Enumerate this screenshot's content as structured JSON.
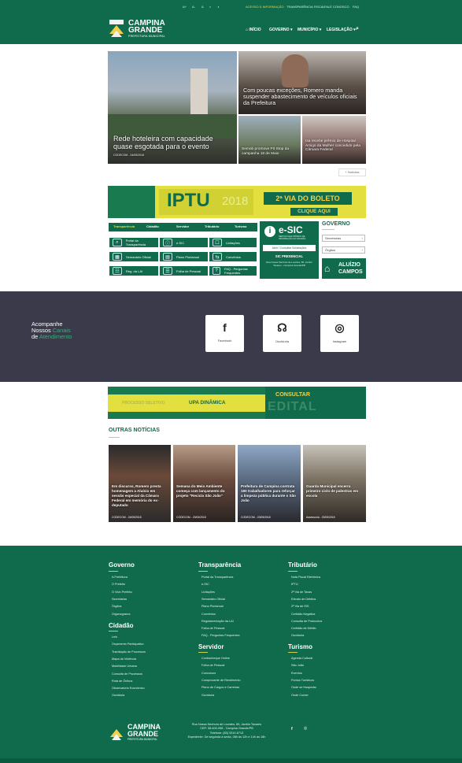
{
  "topbar": {
    "items": [
      "A+",
      "A-",
      "A",
      "◐",
      "◑",
      "ACESSO À INFORMAÇÃO",
      "TRANSPARÊNCIA FISCAL",
      "FALE CONOSCO",
      "FAQ"
    ]
  },
  "header": {
    "logo_line1": "CAMPINA",
    "logo_line2": "GRANDE",
    "logo_sub": "PREFEITURA MUNICIPAL",
    "nav": [
      "INÍCIO",
      "GOVERNO",
      "MUNICÍPIO",
      "LEGISLAÇÃO"
    ]
  },
  "slides": {
    "big": {
      "title": "Rede hoteleira com capacidade quase esgotada para o evento",
      "meta": "CODECOM - 24/05/2018"
    },
    "r1": {
      "title": "Com poucas exceções, Romero manda suspender abastecimento de veículos oficiais da Prefeitura"
    },
    "r2": {
      "title": "Semob promove Pit Stop da campanha 18 de Maio"
    },
    "r3": {
      "title": "Isa recebe prêmio de Hospital Amigo da Mulher concedido pela Câmara Federal"
    },
    "more": "Notícias"
  },
  "iptu": {
    "word": "IPTU",
    "year": "2018",
    "via": "2ª VIA DO BOLETO",
    "click": "CLIQUE AQUI"
  },
  "tabs": [
    "Transparência",
    "Cidadão",
    "Servidor",
    "Tributário",
    "Turismo"
  ],
  "services": [
    {
      "label": "Portal da Transparência",
      "icon": "⌕"
    },
    {
      "label": "e-SIC",
      "icon": "ⓘ"
    },
    {
      "label": "Licitações",
      "icon": "☐"
    },
    {
      "label": "Semanário Oficial",
      "icon": "▦"
    },
    {
      "label": "Plano Plurianual",
      "icon": "▤"
    },
    {
      "label": "Convênios",
      "icon": "⇆"
    },
    {
      "label": "Reg. da LAI",
      "icon": "☷"
    },
    {
      "label": "Folha de Pessoal",
      "icon": "☰"
    },
    {
      "label": "FAQ - Perguntas Frequentes",
      "icon": "?"
    }
  ],
  "esic": {
    "title": "e-SIC",
    "sub": "SERVIÇO ELETRÔNICO DE INFORMAÇÃO AO CIDADÃO",
    "btn": "Abrir / Consultar Solicitações",
    "presencial": "SIC PRESENCIAL",
    "address": "Rua Nossa Senhora de Lourdes, 85, Jardim Tavares - Campina Grande/PB"
  },
  "governo": {
    "title": "GOVERNO",
    "select1": "Secretarias",
    "select2": "Órgãos",
    "aluizio1": "ALUÍZIO",
    "aluizio2": "CAMPOS"
  },
  "follow": {
    "line1": "Acompanhe",
    "line2": "Nossos",
    "line2b": "Canais",
    "line3": "de",
    "line3b": "Atendimento",
    "social": [
      {
        "icon": "f",
        "label": "Facebook"
      },
      {
        "icon": "☊",
        "label": "Ouvidoria"
      },
      {
        "icon": "◎",
        "label": "Instagram"
      }
    ]
  },
  "edital": {
    "left1": "PROCESSO SELETIVO",
    "left2": "UPA DINÂMICA",
    "consultar": "CONSULTAR",
    "edital": "EDITAL"
  },
  "outras": {
    "heading": "OUTRAS NOTÍCIAS",
    "items": [
      {
        "title": "Em discurso, Romero presta homenagem a Aluísio em sessão especial da Câmara Federal em memória do ex-deputado",
        "meta": "CODECOM - 24/05/2018"
      },
      {
        "title": "Semana do Meio Ambiente começa com lançamento do projeto \"Recicla São João\"",
        "meta": "CODECOM - 23/05/2018"
      },
      {
        "title": "Prefeitura de Campina contrata 180 trabalhadores para reforçar a limpeza pública durante o São João",
        "meta": "CODECOM - 23/05/2018"
      },
      {
        "title": "Guarda Municipal encerra primeiro ciclo de palestras em escola",
        "meta": "Assessoria - 23/05/2018"
      }
    ]
  },
  "footer": {
    "governo": {
      "title": "Governo",
      "items": [
        "A Prefeitura",
        "O Prefeito",
        "O Vice-Prefeito",
        "Secretarias",
        "Órgãos",
        "Organograma"
      ]
    },
    "cidadao": {
      "title": "Cidadão",
      "items": [
        "Leis",
        "Orçamento Participativo",
        "Tramitação de Processos",
        "Mapa da Violência",
        "Mobilidade Urbana",
        "Consulta de Processos",
        "Rota de Ônibus",
        "Observatório Econômico",
        "Ouvidoria"
      ]
    },
    "transparencia": {
      "title": "Transparência",
      "items": [
        "Portal da Transparência",
        "e-SIC",
        "Licitações",
        "Semanário Oficial",
        "Plano Plurianual",
        "Convênios",
        "Regulamentação da LAI",
        "Folha de Pessoal",
        "FAQ - Perguntas Frequentes"
      ]
    },
    "servidor": {
      "title": "Servidor",
      "items": [
        "Contracheque Online",
        "Folha de Pessoal",
        "Concursos",
        "Comprovante de Rendimento",
        "Plano de Cargos e Carreiras",
        "Ouvidoria"
      ]
    },
    "tributario": {
      "title": "Tributário",
      "items": [
        "Nota Fiscal Eletrônica",
        "IPTU",
        "2ª Via de Taxas",
        "Extrato de Débitos",
        "2ª Via de ISS",
        "Certidão Negativa",
        "Consulta de Protocolos",
        "Certidão de Débito",
        "Ouvidoria"
      ]
    },
    "turismo": {
      "title": "Turismo",
      "items": [
        "Agenda Cultural",
        "São João",
        "Eventos",
        "Pontos Turísticos",
        "Onde se Hospedar",
        "Onde Comer"
      ]
    },
    "address1": "Rua Nossa Senhora de Lourdes, 85, Jardim Tavares",
    "address2": "CEP: 58.400-058 - Campina Grande/PB",
    "address3": "Telefone: (83) 3310-6713",
    "address4": "Expediente: De segunda à sexta, 08h às 12h e 14h às 18h"
  }
}
